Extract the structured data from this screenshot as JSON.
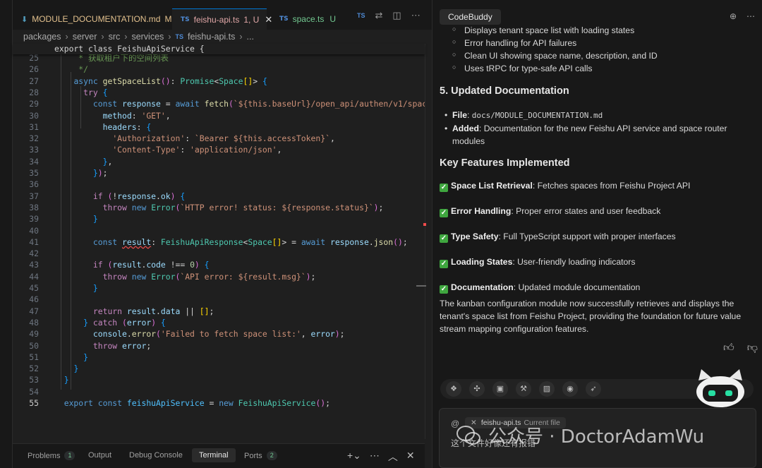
{
  "editor": {
    "tabs": [
      {
        "name": "MODULE_DOCUMENTATION.md",
        "status": "M"
      },
      {
        "name": "feishu-api.ts",
        "status": "1, U"
      },
      {
        "name": "space.ts",
        "status": "U"
      }
    ],
    "breadcrumb": [
      "packages",
      "server",
      "src",
      "services",
      "feishu-api.ts",
      "..."
    ],
    "sticky_header": "export class FeishuApiService {",
    "lines": [
      {
        "n": "25",
        "t": "     * 获取租户下的空间列表"
      },
      {
        "n": "26",
        "t": "     */"
      },
      {
        "n": "27",
        "t": "    async getSpaceList(): Promise<Space[]> {"
      },
      {
        "n": "28",
        "t": "      try {"
      },
      {
        "n": "29",
        "t": "        const response = await fetch(`${this.baseUrl}/open_api/authen/v1/space/list"
      },
      {
        "n": "30",
        "t": "          method: 'GET',"
      },
      {
        "n": "31",
        "t": "          headers: {"
      },
      {
        "n": "32",
        "t": "            'Authorization': `Bearer ${this.accessToken}`,"
      },
      {
        "n": "33",
        "t": "            'Content-Type': 'application/json',"
      },
      {
        "n": "34",
        "t": "          },"
      },
      {
        "n": "35",
        "t": "        });"
      },
      {
        "n": "36",
        "t": ""
      },
      {
        "n": "37",
        "t": "        if (!response.ok) {"
      },
      {
        "n": "38",
        "t": "          throw new Error(`HTTP error! status: ${response.status}`);"
      },
      {
        "n": "39",
        "t": "        }"
      },
      {
        "n": "40",
        "t": ""
      },
      {
        "n": "41",
        "t": "        const result: FeishuApiResponse<Space[]> = await response.json();"
      },
      {
        "n": "42",
        "t": ""
      },
      {
        "n": "43",
        "t": "        if (result.code !== 0) {"
      },
      {
        "n": "44",
        "t": "          throw new Error(`API error: ${result.msg}`);"
      },
      {
        "n": "45",
        "t": "        }"
      },
      {
        "n": "46",
        "t": ""
      },
      {
        "n": "47",
        "t": "        return result.data || [];"
      },
      {
        "n": "48",
        "t": "      } catch (error) {"
      },
      {
        "n": "49",
        "t": "        console.error('Failed to fetch space list:', error);"
      },
      {
        "n": "50",
        "t": "        throw error;"
      },
      {
        "n": "51",
        "t": "      }"
      },
      {
        "n": "52",
        "t": "    }"
      },
      {
        "n": "53",
        "t": "  }"
      },
      {
        "n": "54",
        "t": ""
      },
      {
        "n": "55",
        "t": "  export const feishuApiService = new FeishuApiService();"
      }
    ],
    "active_line": "55"
  },
  "panel": {
    "tabs": [
      {
        "label": "Problems",
        "badge": "1"
      },
      {
        "label": "Output"
      },
      {
        "label": "Debug Console"
      },
      {
        "label": "Terminal"
      },
      {
        "label": "Ports",
        "badge": "2"
      }
    ],
    "active_tab": "Terminal"
  },
  "chat": {
    "title": "CodeBuddy",
    "bullets_top": [
      "Displays tenant space list with loading states",
      "Error handling for API failures",
      "Clean UI showing space name, description, and ID",
      "Uses tRPC for type-safe API calls"
    ],
    "section5_title": "5. Updated Documentation",
    "doc_items": [
      {
        "label": "File",
        "sep": ": ",
        "value": "docs/MODULE_DOCUMENTATION.md"
      },
      {
        "label": "Added",
        "sep": ": ",
        "value": "Documentation for the new Feishu API service and space router"
      },
      {
        "label": "",
        "sep": "",
        "value": "modules"
      }
    ],
    "features_title": "Key Features Implemented",
    "features": [
      {
        "label": "Space List Retrieval",
        "text": ": Fetches spaces from Feishu Project API"
      },
      {
        "label": "Error Handling",
        "text": ": Proper error states and user feedback"
      },
      {
        "label": "Type Safety",
        "text": ": Full TypeScript support with proper interfaces"
      },
      {
        "label": "Loading States",
        "text": ": User-friendly loading indicators"
      },
      {
        "label": "Documentation",
        "text": ": Updated module documentation"
      }
    ],
    "summary_lines": [
      "The kanban configuration module now successfully retrieves and displays the",
      "tenant's space list from Feishu Project, providing the foundation for future value",
      "stream mapping configuration features."
    ],
    "input": {
      "at_symbol": "@",
      "file_chip": "feishu-api.ts",
      "file_chip_note": "Current file",
      "placeholder": "这个文件好像还有报错"
    }
  },
  "watermark": {
    "text": "公众号 · DoctorAdamWu"
  },
  "colors": {
    "editor_bg": "#1f1f1f",
    "sidebar_bg": "#181818",
    "accent": "#0078d4",
    "check_green": "#3fa63f"
  }
}
